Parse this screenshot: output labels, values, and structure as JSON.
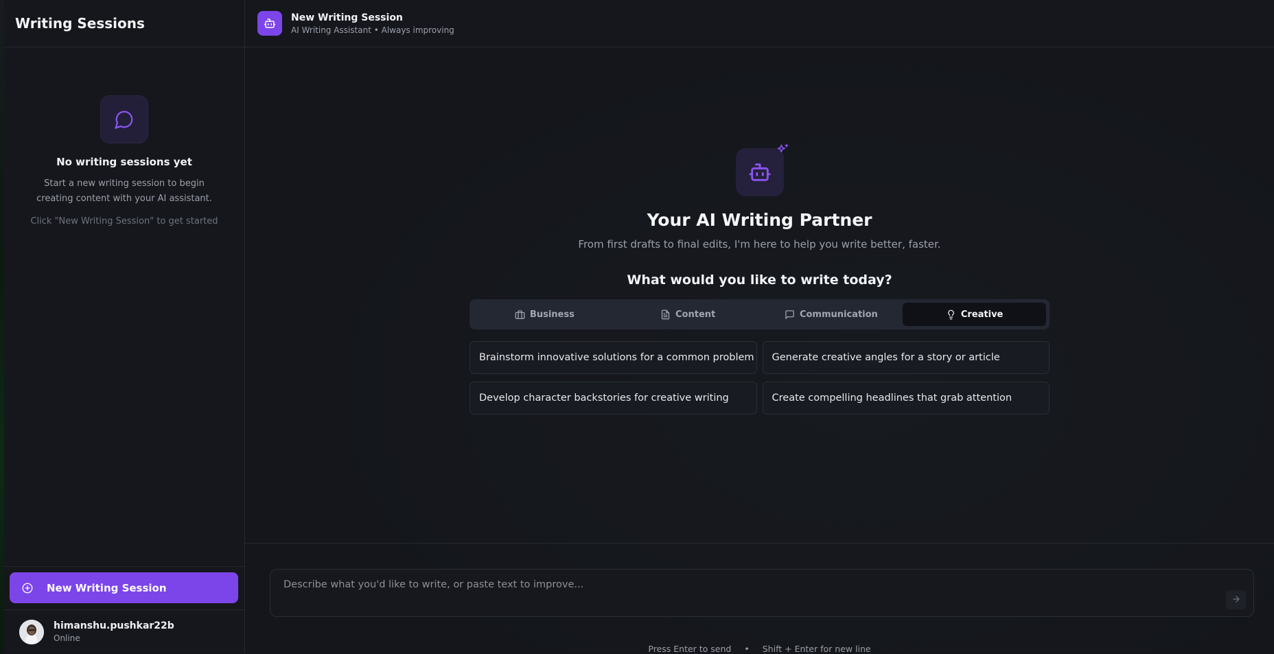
{
  "sidebar": {
    "title": "Writing Sessions",
    "empty_title": "No writing sessions yet",
    "empty_description": "Start a new writing session to begin creating content with your AI assistant.",
    "empty_hint": "Click \"New Writing Session\" to get started",
    "new_session_label": "New Writing Session",
    "user": {
      "name": "himanshu.pushkar22b",
      "status": "Online"
    }
  },
  "header": {
    "title": "New Writing Session",
    "subtitle": "AI Writing Assistant • Always improving"
  },
  "hero": {
    "title": "Your AI Writing Partner",
    "subtitle": "From first drafts to final edits, I'm here to help you write better, faster.",
    "question": "What would you like to write today?"
  },
  "tabs": [
    {
      "label": "Business",
      "icon": "briefcase-icon",
      "active": false
    },
    {
      "label": "Content",
      "icon": "document-icon",
      "active": false
    },
    {
      "label": "Communication",
      "icon": "message-icon",
      "active": false
    },
    {
      "label": "Creative",
      "icon": "lightbulb-icon",
      "active": true
    }
  ],
  "suggestions": [
    "Brainstorm innovative solutions for a common problem",
    "Generate creative angles for a story or article",
    "Develop character backstories for creative writing",
    "Create compelling headlines that grab attention"
  ],
  "composer": {
    "placeholder": "Describe what you'd like to write, or paste text to improve...",
    "hint_send": "Press Enter to send",
    "hint_separator": "•",
    "hint_newline": "Shift + Enter for new line"
  },
  "colors": {
    "accent": "#7c45ea",
    "background": "#14161b",
    "sidebar": "#15171c"
  }
}
